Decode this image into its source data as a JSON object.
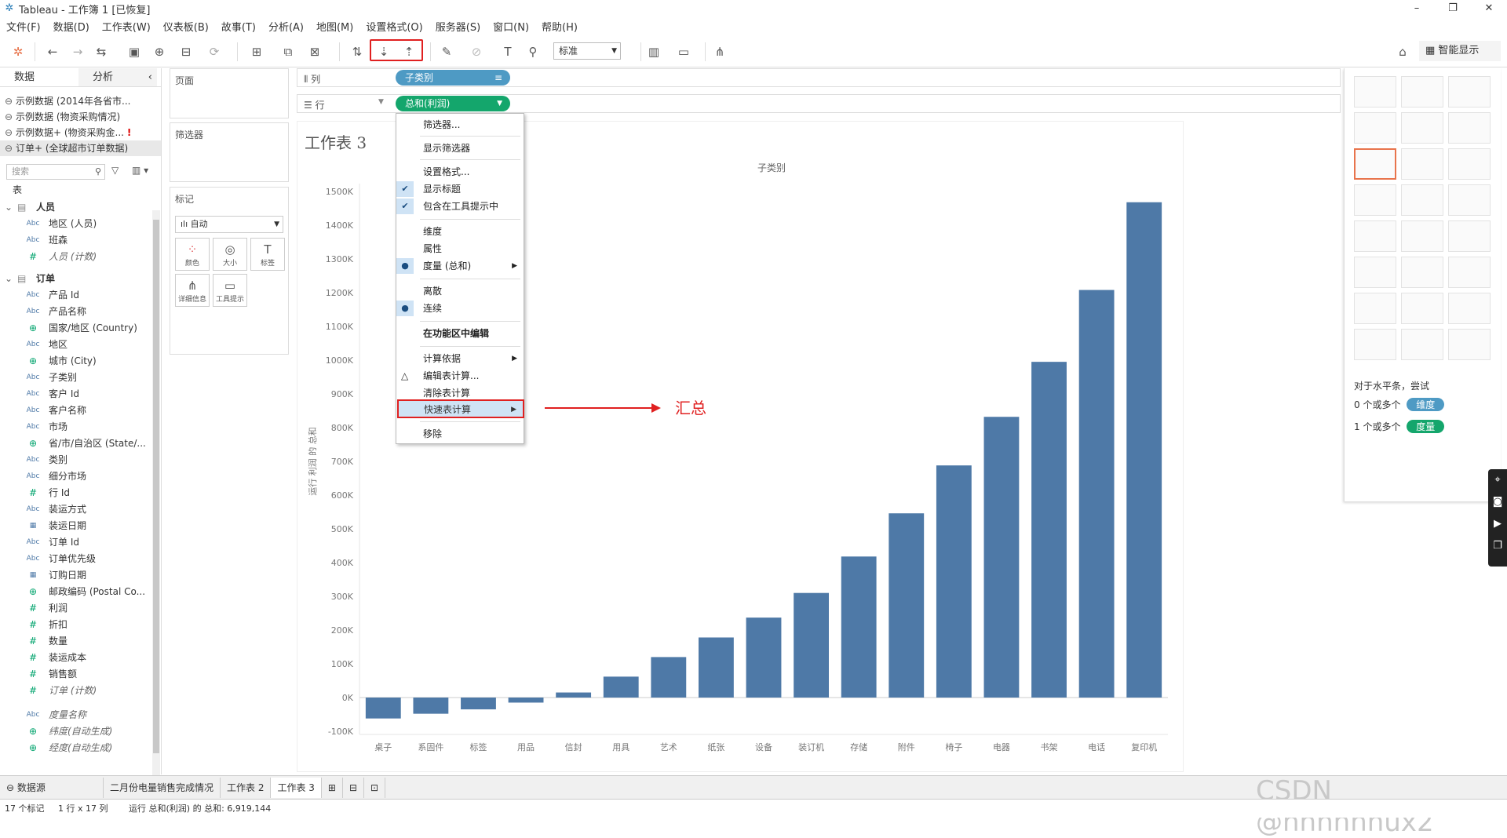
{
  "window": {
    "title": "Tableau - 工作簿 1 [已恢复]",
    "minimize": "–",
    "restore": "❐",
    "close": "✕"
  },
  "menu": [
    "文件(F)",
    "数据(D)",
    "工作表(W)",
    "仪表板(B)",
    "故事(T)",
    "分析(A)",
    "地图(M)",
    "设置格式(O)",
    "服务器(S)",
    "窗口(N)",
    "帮助(H)"
  ],
  "toolbar": {
    "fit_value": "标准",
    "smart_show": "智能显示"
  },
  "data_pane": {
    "tab_data": "数据",
    "tab_analysis": "分析",
    "datasources": [
      "示例数据 (2014年各省市...",
      "示例数据 (物资采购情况)",
      "示例数据+ (物资采购金...",
      "订单+ (全球超市订单数据)"
    ],
    "warning": "!",
    "search_placeholder": "搜索",
    "tables_label": "表",
    "group_people": "人员",
    "people_fields": [
      {
        "type": "Abc",
        "name": "地区 (人员)"
      },
      {
        "type": "Abc",
        "name": "班森"
      },
      {
        "type": "#",
        "name": "人员 (计数)"
      }
    ],
    "group_orders": "订单",
    "order_fields": [
      {
        "type": "Abc",
        "name": "产品 Id"
      },
      {
        "type": "Abc",
        "name": "产品名称"
      },
      {
        "type": "⊕",
        "name": "国家/地区 (Country)"
      },
      {
        "type": "Abc",
        "name": "地区"
      },
      {
        "type": "⊕",
        "name": "城市 (City)"
      },
      {
        "type": "Abc",
        "name": "子类别"
      },
      {
        "type": "Abc",
        "name": "客户 Id"
      },
      {
        "type": "Abc",
        "name": "客户名称"
      },
      {
        "type": "Abc",
        "name": "市场"
      },
      {
        "type": "⊕",
        "name": "省/市/自治区 (State/..."
      },
      {
        "type": "Abc",
        "name": "类别"
      },
      {
        "type": "Abc",
        "name": "细分市场"
      },
      {
        "type": "#",
        "name": "行 Id"
      },
      {
        "type": "Abc",
        "name": "装运方式"
      },
      {
        "type": "▦",
        "name": "装运日期"
      },
      {
        "type": "Abc",
        "name": "订单 Id"
      },
      {
        "type": "Abc",
        "name": "订单优先级"
      },
      {
        "type": "▦",
        "name": "订购日期"
      },
      {
        "type": "⊕",
        "name": "邮政编码 (Postal Co..."
      },
      {
        "type": "#",
        "name": "利润"
      },
      {
        "type": "#",
        "name": "折扣"
      },
      {
        "type": "#",
        "name": "数量"
      },
      {
        "type": "#",
        "name": "装运成本"
      },
      {
        "type": "#",
        "name": "销售额"
      },
      {
        "type": "#",
        "name": "订单 (计数)"
      }
    ],
    "extra_fields": [
      {
        "type": "Abc",
        "name": "度量名称"
      },
      {
        "type": "⊕",
        "name": "纬度(自动生成)"
      },
      {
        "type": "⊕",
        "name": "经度(自动生成)"
      }
    ]
  },
  "cards": {
    "pages": "页面",
    "filters": "筛选器",
    "marks": "标记",
    "mark_type": "自动",
    "mark_buttons": [
      "颜色",
      "大小",
      "标签",
      "详细信息",
      "工具提示"
    ]
  },
  "shelves": {
    "columns_label": "列",
    "rows_label": "行",
    "column_pill": "子类别",
    "row_pill": "总和(利润)"
  },
  "context_menu": {
    "items": [
      "筛选器...",
      "显示筛选器",
      "设置格式...",
      "显示标题",
      "包含在工具提示中",
      "维度",
      "属性",
      "度量 (总和)",
      "离散",
      "连续",
      "在功能区中编辑",
      "计算依据",
      "编辑表计算...",
      "清除表计算",
      "快速表计算",
      "移除"
    ]
  },
  "annotation": {
    "text": "汇总"
  },
  "sheet": {
    "title": "工作表 3"
  },
  "chart_data": {
    "type": "bar",
    "title": "子类别",
    "ylabel": "运行 利润 的 总和",
    "xlabel": "",
    "ylim": [
      -100000,
      1500000
    ],
    "yticks": [
      "-100K",
      "0K",
      "100K",
      "200K",
      "300K",
      "400K",
      "500K",
      "600K",
      "700K",
      "800K",
      "900K",
      "1000K",
      "1100K",
      "1200K",
      "1300K",
      "1400K",
      "1500K"
    ],
    "categories": [
      "桌子",
      "系固件",
      "标签",
      "用品",
      "信封",
      "用具",
      "艺术",
      "纸张",
      "设备",
      "装订机",
      "存储",
      "附件",
      "椅子",
      "电器",
      "书架",
      "电话",
      "复印机"
    ],
    "values": [
      -62000,
      -48000,
      -35000,
      -15000,
      15000,
      62000,
      120000,
      178000,
      237000,
      310000,
      418000,
      546000,
      688000,
      832000,
      995000,
      1208000,
      1468000
    ],
    "color": "#4e79a7",
    "grid": false
  },
  "show_me": {
    "hint": "对于水平条，尝试",
    "req1_prefix": "0 个或多个",
    "req1_badge": "维度",
    "req2_prefix": "1 个或多个",
    "req2_badge": "度量"
  },
  "tabs": {
    "datasource": "数据源",
    "sheets": [
      "二月份电量销售完成情况",
      "工作表 2",
      "工作表 3"
    ]
  },
  "status": {
    "marks": "17 个标记",
    "dims": "1 行 x 17 列",
    "sum": "运行 总和(利润) 的 总和: 6,919,144"
  },
  "watermark": "CSDN @hhhhhhux2"
}
